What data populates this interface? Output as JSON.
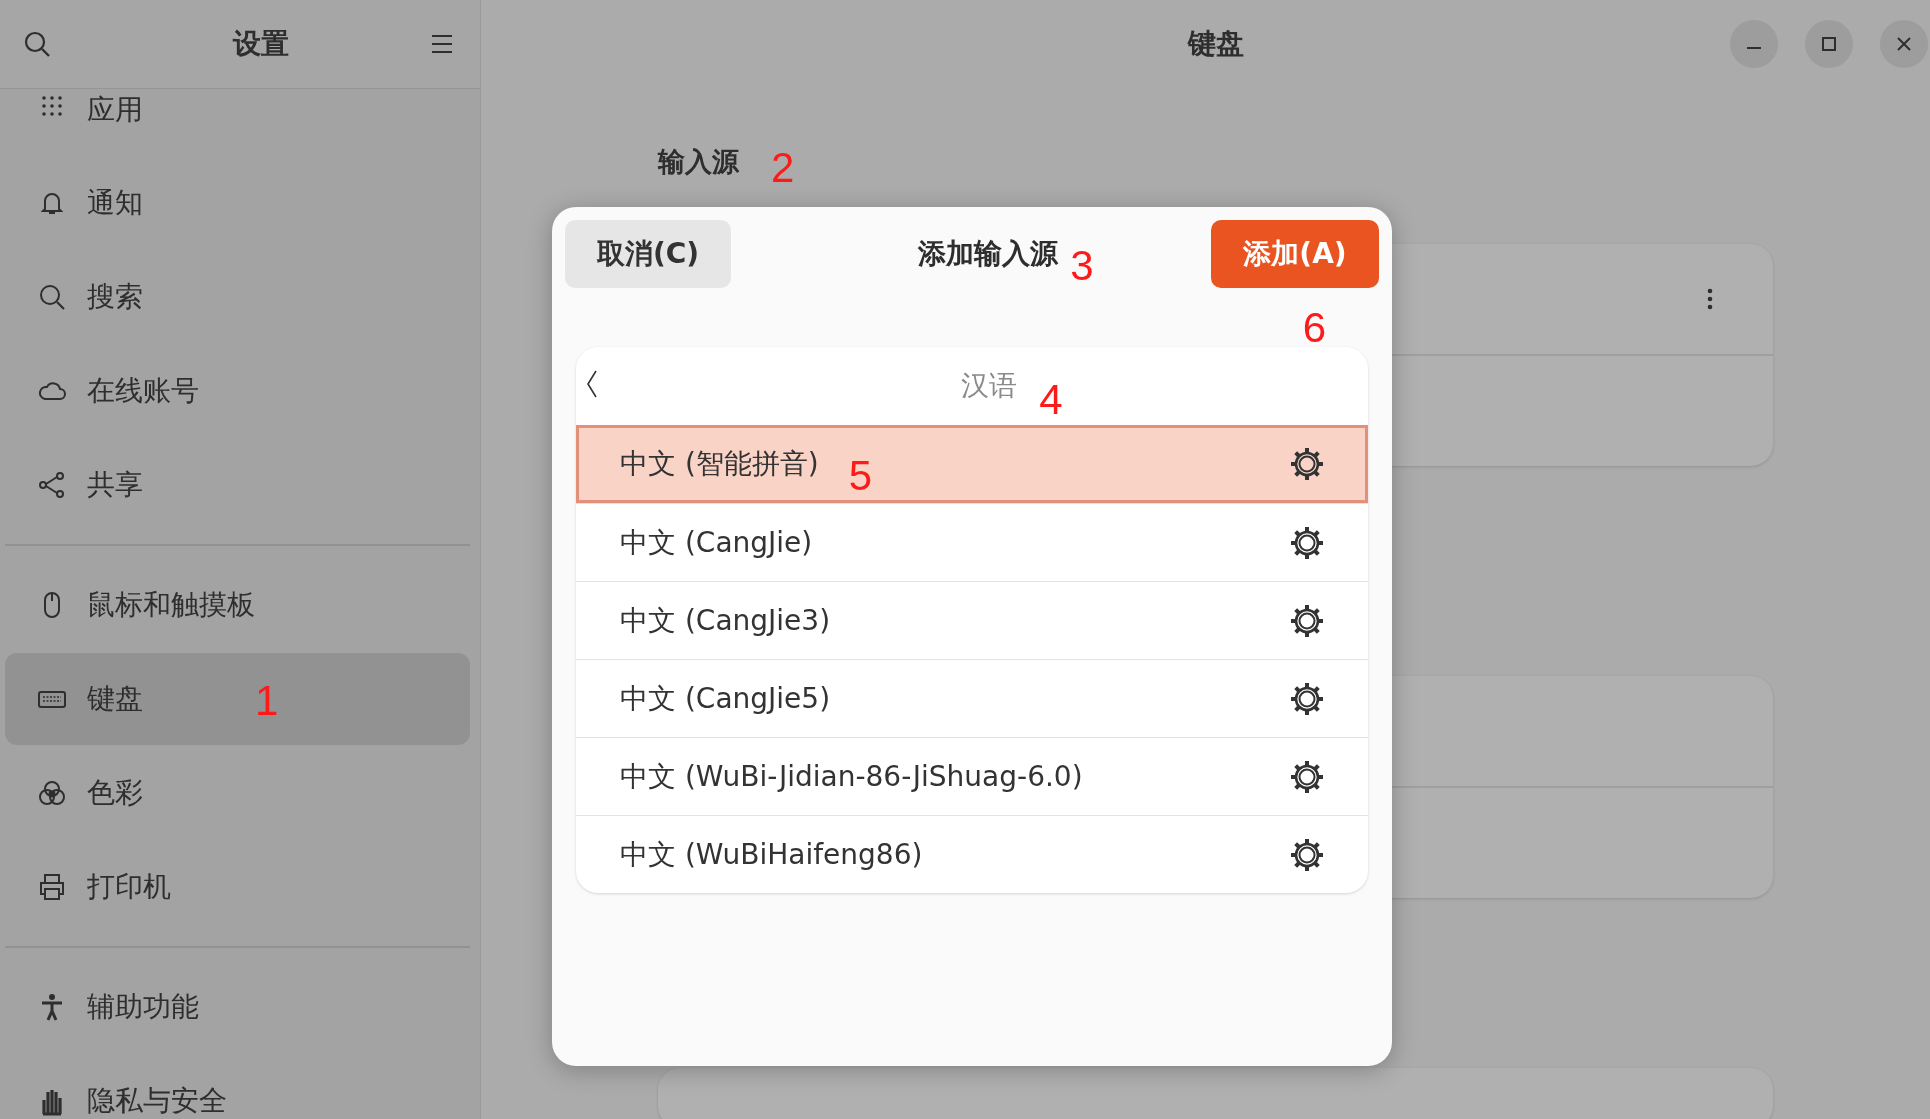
{
  "sidebar": {
    "title": "设置",
    "groups": [
      [
        {
          "label": "应用",
          "selected": false
        },
        {
          "label": "通知",
          "selected": false
        },
        {
          "label": "搜索",
          "selected": false
        },
        {
          "label": "在线账号",
          "selected": false
        },
        {
          "label": "共享",
          "selected": false
        }
      ],
      [
        {
          "label": "鼠标和触摸板",
          "selected": false
        },
        {
          "label": "键盘",
          "selected": true,
          "annotation": "1"
        },
        {
          "label": "色彩",
          "selected": false
        },
        {
          "label": "打印机",
          "selected": false
        }
      ],
      [
        {
          "label": "辅助功能",
          "selected": false
        },
        {
          "label": "隐私与安全",
          "selected": false
        }
      ]
    ]
  },
  "window": {
    "title": "键盘"
  },
  "section": {
    "title": "输入源",
    "annotation": "2"
  },
  "dialog": {
    "cancel": "取消(C)",
    "title": "添加输入源",
    "title_annotation": "3",
    "add": "添加(A)",
    "add_annotation": "6",
    "list": {
      "heading": "汉语",
      "heading_annotation": "4",
      "rows": [
        {
          "label": "中文 (智能拼音)",
          "selected": true,
          "annotation": "5"
        },
        {
          "label": "中文 (CangJie)",
          "selected": false
        },
        {
          "label": "中文 (CangJie3)",
          "selected": false
        },
        {
          "label": "中文 (CangJie5)",
          "selected": false
        },
        {
          "label": "中文 (WuBi-Jidian-86-JiShuag-6.0)",
          "selected": false
        },
        {
          "label": "中文 (WuBiHaifeng86)",
          "selected": false
        }
      ]
    }
  }
}
